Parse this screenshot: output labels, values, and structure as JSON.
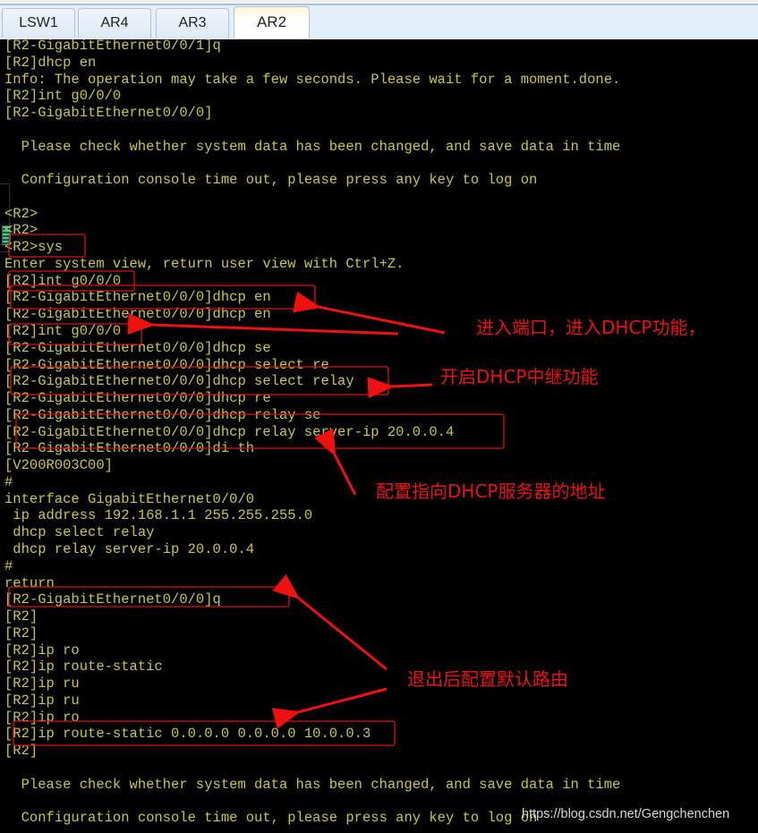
{
  "tabs": [
    {
      "label": "LSW1",
      "active": false
    },
    {
      "label": "AR4",
      "active": false
    },
    {
      "label": "AR3",
      "active": false
    },
    {
      "label": "AR2",
      "active": true
    }
  ],
  "terminal": {
    "text_color": "#c9c83a",
    "background": "#000000",
    "lines": [
      "[R2-GigabitEthernet0/0/1]q",
      "[R2]dhcp en",
      "Info: The operation may take a few seconds. Please wait for a moment.done.",
      "[R2]int g0/0/0",
      "[R2-GigabitEthernet0/0/0]",
      "",
      "  Please check whether system data has been changed, and save data in time",
      "",
      "  Configuration console time out, please press any key to log on",
      "",
      "<R2>",
      "<R2>",
      "<R2>sys",
      "Enter system view, return user view with Ctrl+Z.",
      "[R2]int g0/0/0",
      "[R2-GigabitEthernet0/0/0]dhcp en",
      "[R2-GigabitEthernet0/0/0]dhcp en",
      "[R2]int g0/0/0",
      "[R2-GigabitEthernet0/0/0]dhcp se",
      "[R2-GigabitEthernet0/0/0]dhcp select re",
      "[R2-GigabitEthernet0/0/0]dhcp select relay",
      "[R2-GigabitEthernet0/0/0]dhcp re",
      "[R2-GigabitEthernet0/0/0]dhcp relay se",
      "[R2-GigabitEthernet0/0/0]dhcp relay server-ip 20.0.0.4",
      "[R2-GigabitEthernet0/0/0]di th",
      "[V200R003C00]",
      "#",
      "interface GigabitEthernet0/0/0",
      " ip address 192.168.1.1 255.255.255.0",
      " dhcp select relay",
      " dhcp relay server-ip 20.0.0.4",
      "#",
      "return",
      "[R2-GigabitEthernet0/0/0]q",
      "[R2]",
      "[R2]",
      "[R2]ip ro",
      "[R2]ip route-static",
      "[R2]ip ru",
      "[R2]ip ru",
      "[R2]ip ro",
      "[R2]ip route-static 0.0.0.0 0.0.0.0 10.0.0.3",
      "[R2]",
      "",
      "  Please check whether system data has been changed, and save data in time",
      "",
      "  Configuration console time out, please press any key to log on"
    ]
  },
  "annotations": {
    "color": "#f01010",
    "enter_port_dhcp": "进入端口，进入DHCP功能，",
    "enable_relay": "开启DHCP中继功能",
    "server_address": "配置指向DHCP服务器的地址",
    "default_route": "退出后配置默认路由"
  },
  "watermark": "https://blog.csdn.net/Gengchenchen"
}
